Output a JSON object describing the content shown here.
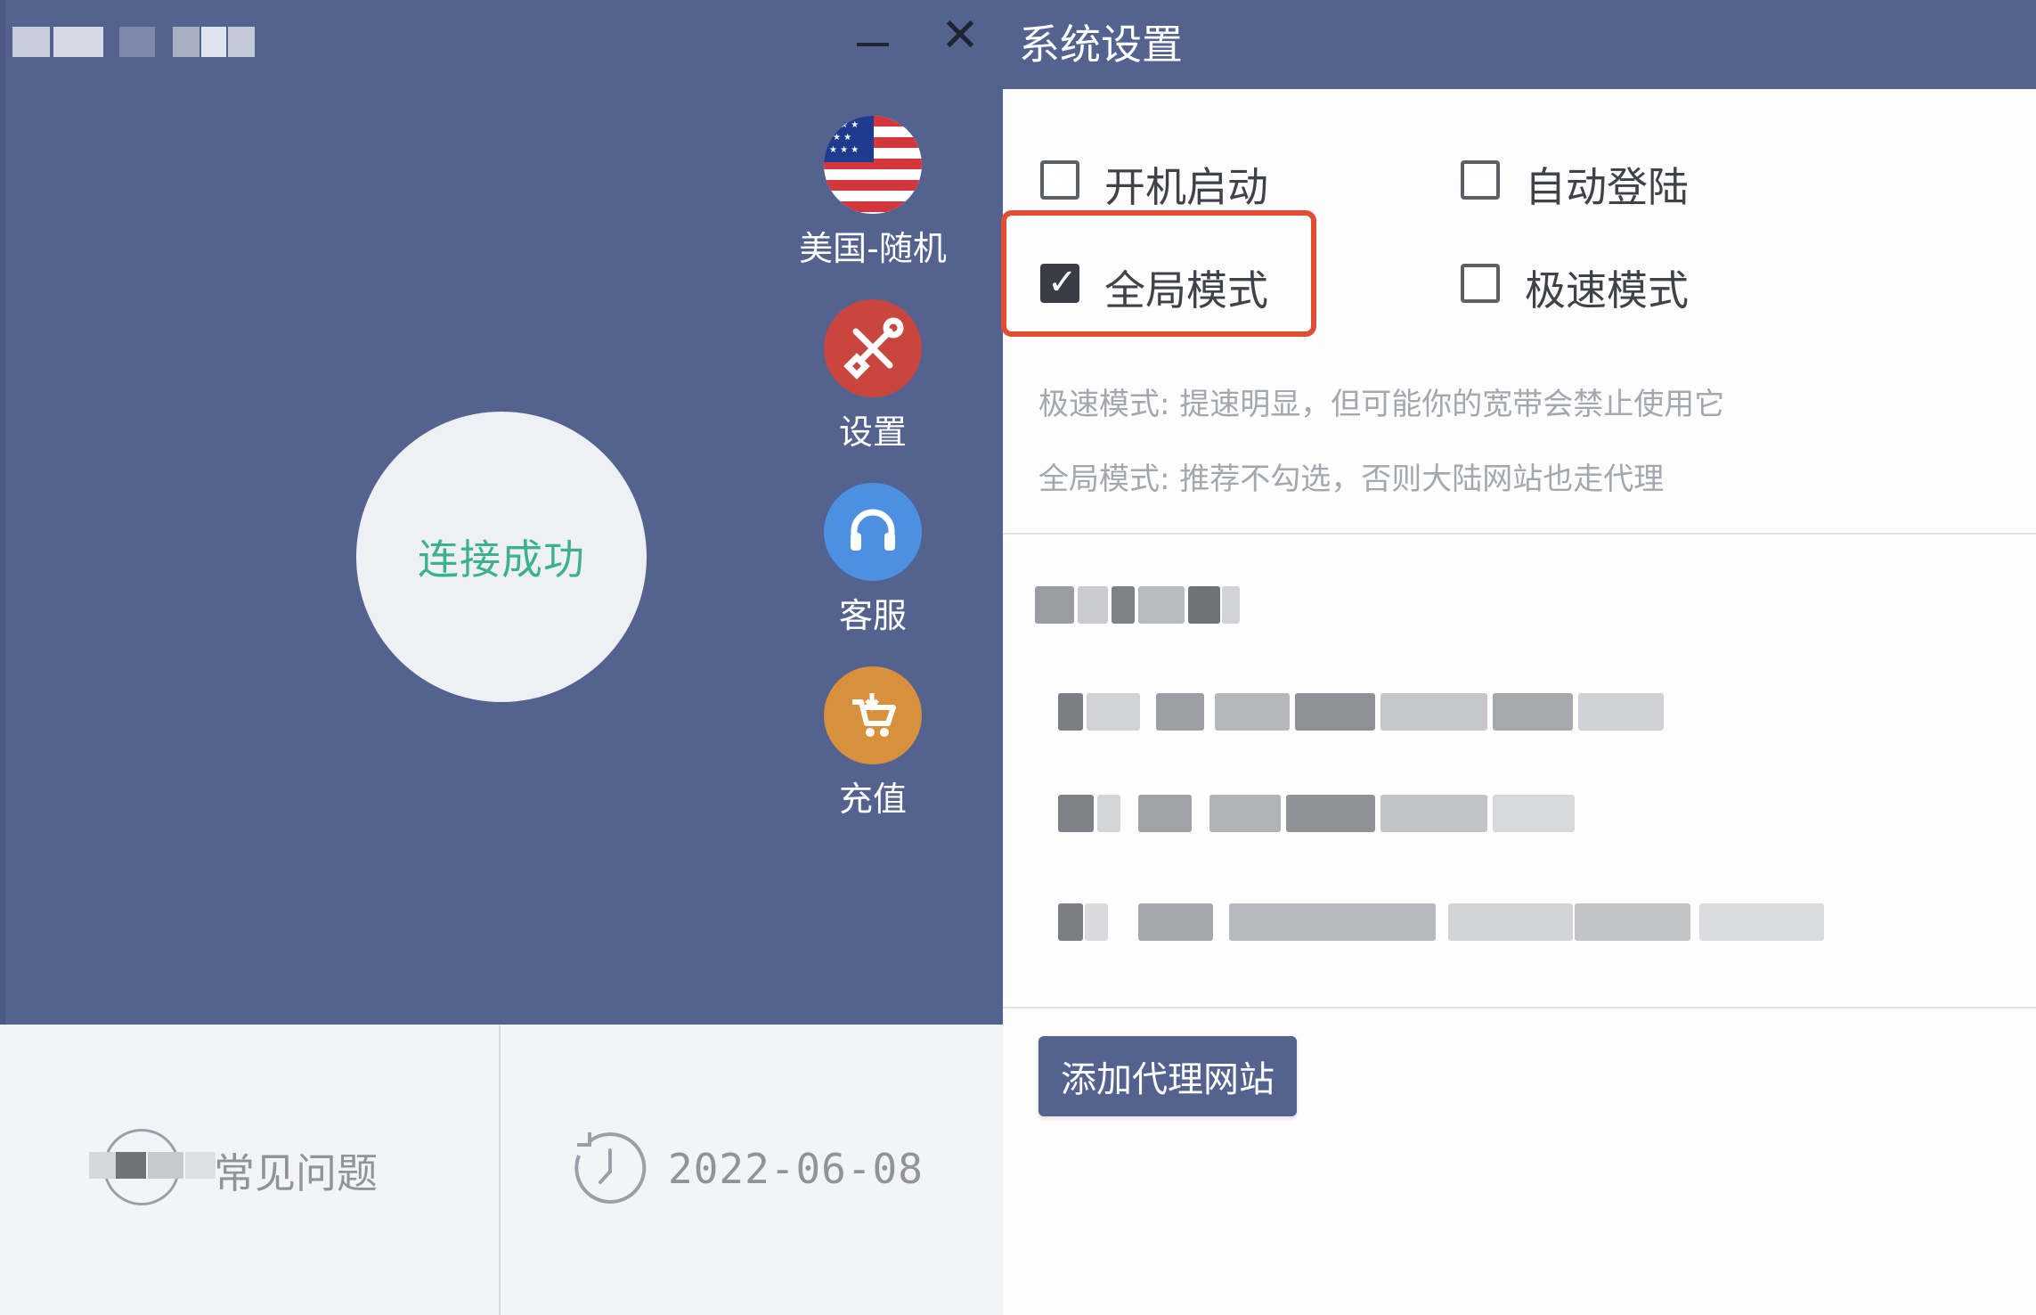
{
  "left": {
    "minimize_label": "–",
    "close_label": "✕",
    "connect_status": "连接成功",
    "side_menu": [
      {
        "label": "美国-随机",
        "icon": "us-flag-icon"
      },
      {
        "label": "设置",
        "icon": "tools-icon",
        "color": "#c9463e"
      },
      {
        "label": "客服",
        "icon": "headset-icon",
        "color": "#4d8fe0"
      },
      {
        "label": "充值",
        "icon": "cart-icon",
        "color": "#d9903c"
      }
    ],
    "faq_label": "常见问题",
    "date": "2022-06-08"
  },
  "settings": {
    "title": "系统设置",
    "options": [
      {
        "label": "开机启动",
        "checked": false
      },
      {
        "label": "自动登陆",
        "checked": false
      },
      {
        "label": "全局模式",
        "checked": true
      },
      {
        "label": "极速模式",
        "checked": false
      }
    ],
    "hint_speed": "极速模式: 提速明显，但可能你的宽带会禁止使用它",
    "hint_global": "全局模式: 推荐不勾选，否则大陆网站也走代理",
    "add_proxy_site_button": "添加代理网站"
  },
  "colors": {
    "header_bg": "#54628f",
    "connect_text": "#3bb28c",
    "highlight_border": "#e04d33"
  }
}
